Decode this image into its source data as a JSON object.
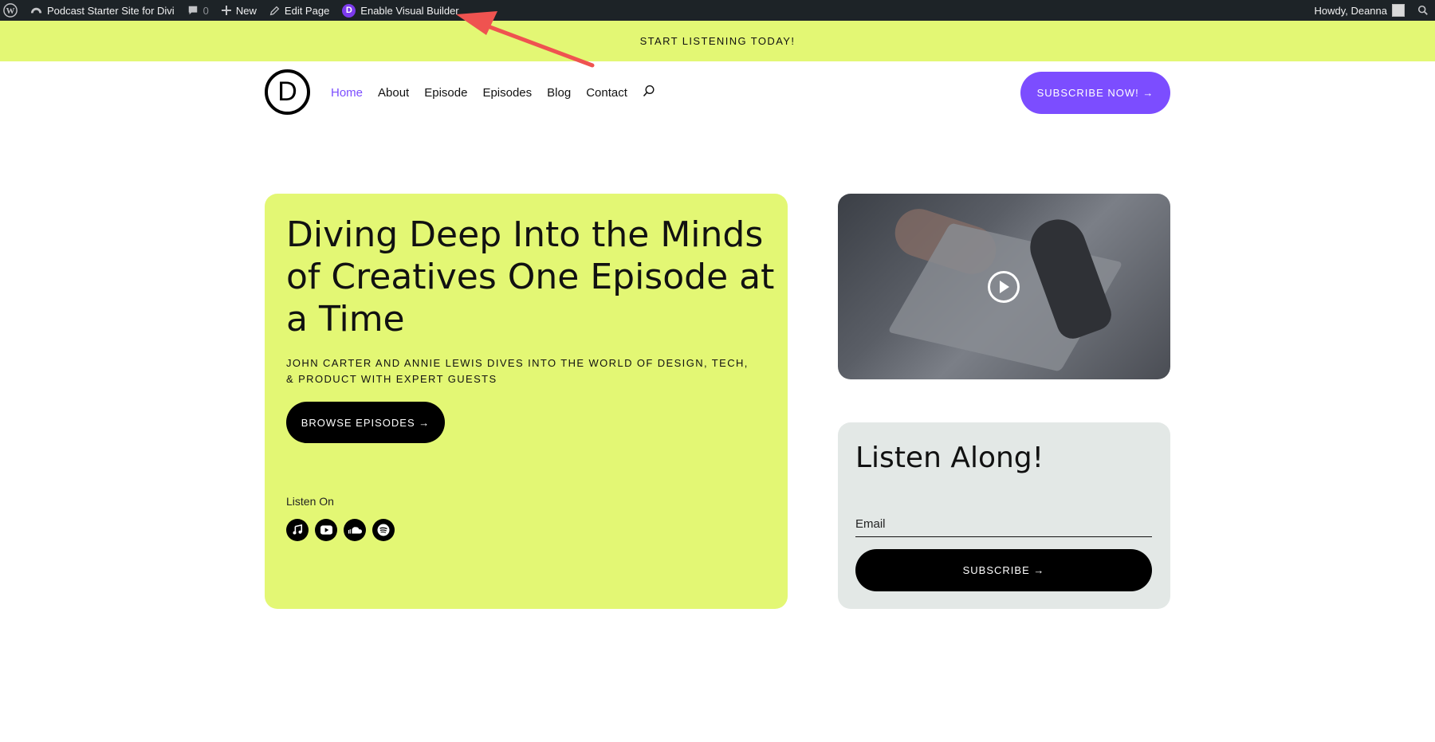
{
  "admin_bar": {
    "site_name": "Podcast Starter Site for Divi",
    "comments_count": "0",
    "new_label": "New",
    "edit_label": "Edit Page",
    "visual_builder_label": "Enable Visual Builder",
    "divi_badge": "D",
    "howdy": "Howdy, Deanna"
  },
  "announcement": "START LISTENING TODAY!",
  "header": {
    "logo_letter": "D",
    "nav": [
      "Home",
      "About",
      "Episode",
      "Episodes",
      "Blog",
      "Contact"
    ],
    "subscribe_label": "SUBSCRIBE NOW! →"
  },
  "hero": {
    "title": "Diving Deep Into the Minds of Creatives One Episode at a Time",
    "subtitle": "JOHN CARTER AND ANNIE LEWIS DIVES INTO THE WORLD OF DESIGN, TECH, & PRODUCT WITH EXPERT GUESTS",
    "browse_label": "BROWSE EPISODES →",
    "listen_on": "Listen On",
    "platforms": [
      "music-icon",
      "youtube-icon",
      "soundcloud-icon",
      "spotify-icon"
    ]
  },
  "signup": {
    "title": "Listen Along!",
    "email_placeholder": "Email",
    "subscribe_label": "SUBSCRIBE →"
  },
  "colors": {
    "accent_lime": "#e3f774",
    "accent_purple": "#7c4dff",
    "annotation_arrow": "#ef5350"
  }
}
